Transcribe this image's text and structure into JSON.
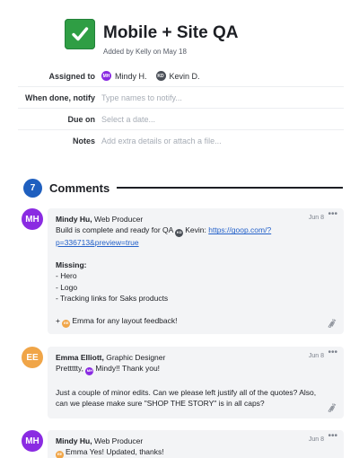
{
  "task": {
    "title": "Mobile + Site QA",
    "added_by": "Added by Kelly on May 18",
    "check_color": "#2f9e44"
  },
  "fields": {
    "assigned_to_label": "Assigned to",
    "assignees": [
      {
        "initials": "MH",
        "name": "Mindy H.",
        "color": "#8a2be2"
      },
      {
        "initials": "KD",
        "name": "Kevin D.",
        "color": "#4a4f57"
      }
    ],
    "when_done_label": "When done, notify",
    "when_done_placeholder": "Type names to notify...",
    "due_on_label": "Due on",
    "due_on_placeholder": "Select a date...",
    "notes_label": "Notes",
    "notes_placeholder": "Add extra details or attach a file..."
  },
  "comments_section": {
    "count": "7",
    "title": "Comments"
  },
  "comments": [
    {
      "initials": "MH",
      "avatar_color": "#8a2be2",
      "author": "Mindy Hu,",
      "role": " Web Producer",
      "date": "Jun 8",
      "more": "•••",
      "line1_text": "Build is complete and ready for QA ",
      "mention_kevin_initials": "KD",
      "mention_kevin": "Kevin: ",
      "link_part1": "https://goop.com/?",
      "link_part2": "p=336713&preview=true",
      "missing_heading": "Missing:",
      "missing_items": [
        "- Hero",
        "- Logo",
        "- Tracking links for Saks products"
      ],
      "footer_prefix": "+ ",
      "mention_emma_initials": "EE",
      "footer_text": "Emma for any layout feedback!"
    },
    {
      "initials": "EE",
      "avatar_color": "#f0a548",
      "author": "Emma Elliott,",
      "role": " Graphic Designer",
      "date": "Jun 8",
      "more": "•••",
      "line1_text": "Prettttty, ",
      "mention_initials": "MH",
      "line1_rest": "Mindy!! Thank you!",
      "para_line1": "Just a couple of minor edits. Can we please left justify all of the quotes? Also,",
      "para_line2": "can we please make sure \"SHOP THE STORY\" is in all caps?"
    },
    {
      "initials": "MH",
      "avatar_color": "#8a2be2",
      "author": "Mindy Hu,",
      "role": " Web Producer",
      "date": "Jun 8",
      "more": "•••",
      "mention_initials": "EE",
      "line1_rest": "Emma Yes! Updated, thanks!"
    }
  ]
}
